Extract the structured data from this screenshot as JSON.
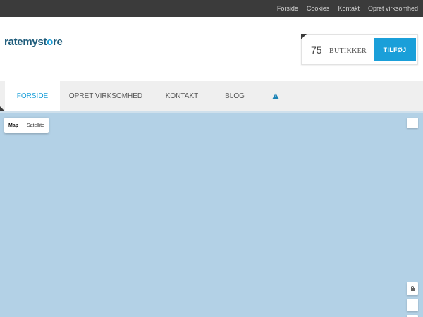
{
  "top_nav": {
    "links": [
      "Forside",
      "Cookies",
      "Kontakt",
      "Opret virksomhed"
    ]
  },
  "header": {
    "logo_part1": "ratemyst",
    "logo_accent": "o",
    "logo_part2": "re",
    "store_count": "75",
    "store_label": "BUTIKKER",
    "add_label": "TILFØJ"
  },
  "main_nav": {
    "items": [
      "FORSIDE",
      "OPRET VIRKSOMHED",
      "KONTAKT",
      "BLOG"
    ],
    "active": "FORSIDE",
    "warning_icon": "warning-icon"
  },
  "map": {
    "type_options": [
      "Map",
      "Satellite"
    ],
    "selected_type": "Map",
    "water_color": "#b3d1e6"
  },
  "colors": {
    "accent": "#1a9fd9",
    "topbar": "#3b3b3b",
    "nav_bg": "#efefef"
  }
}
